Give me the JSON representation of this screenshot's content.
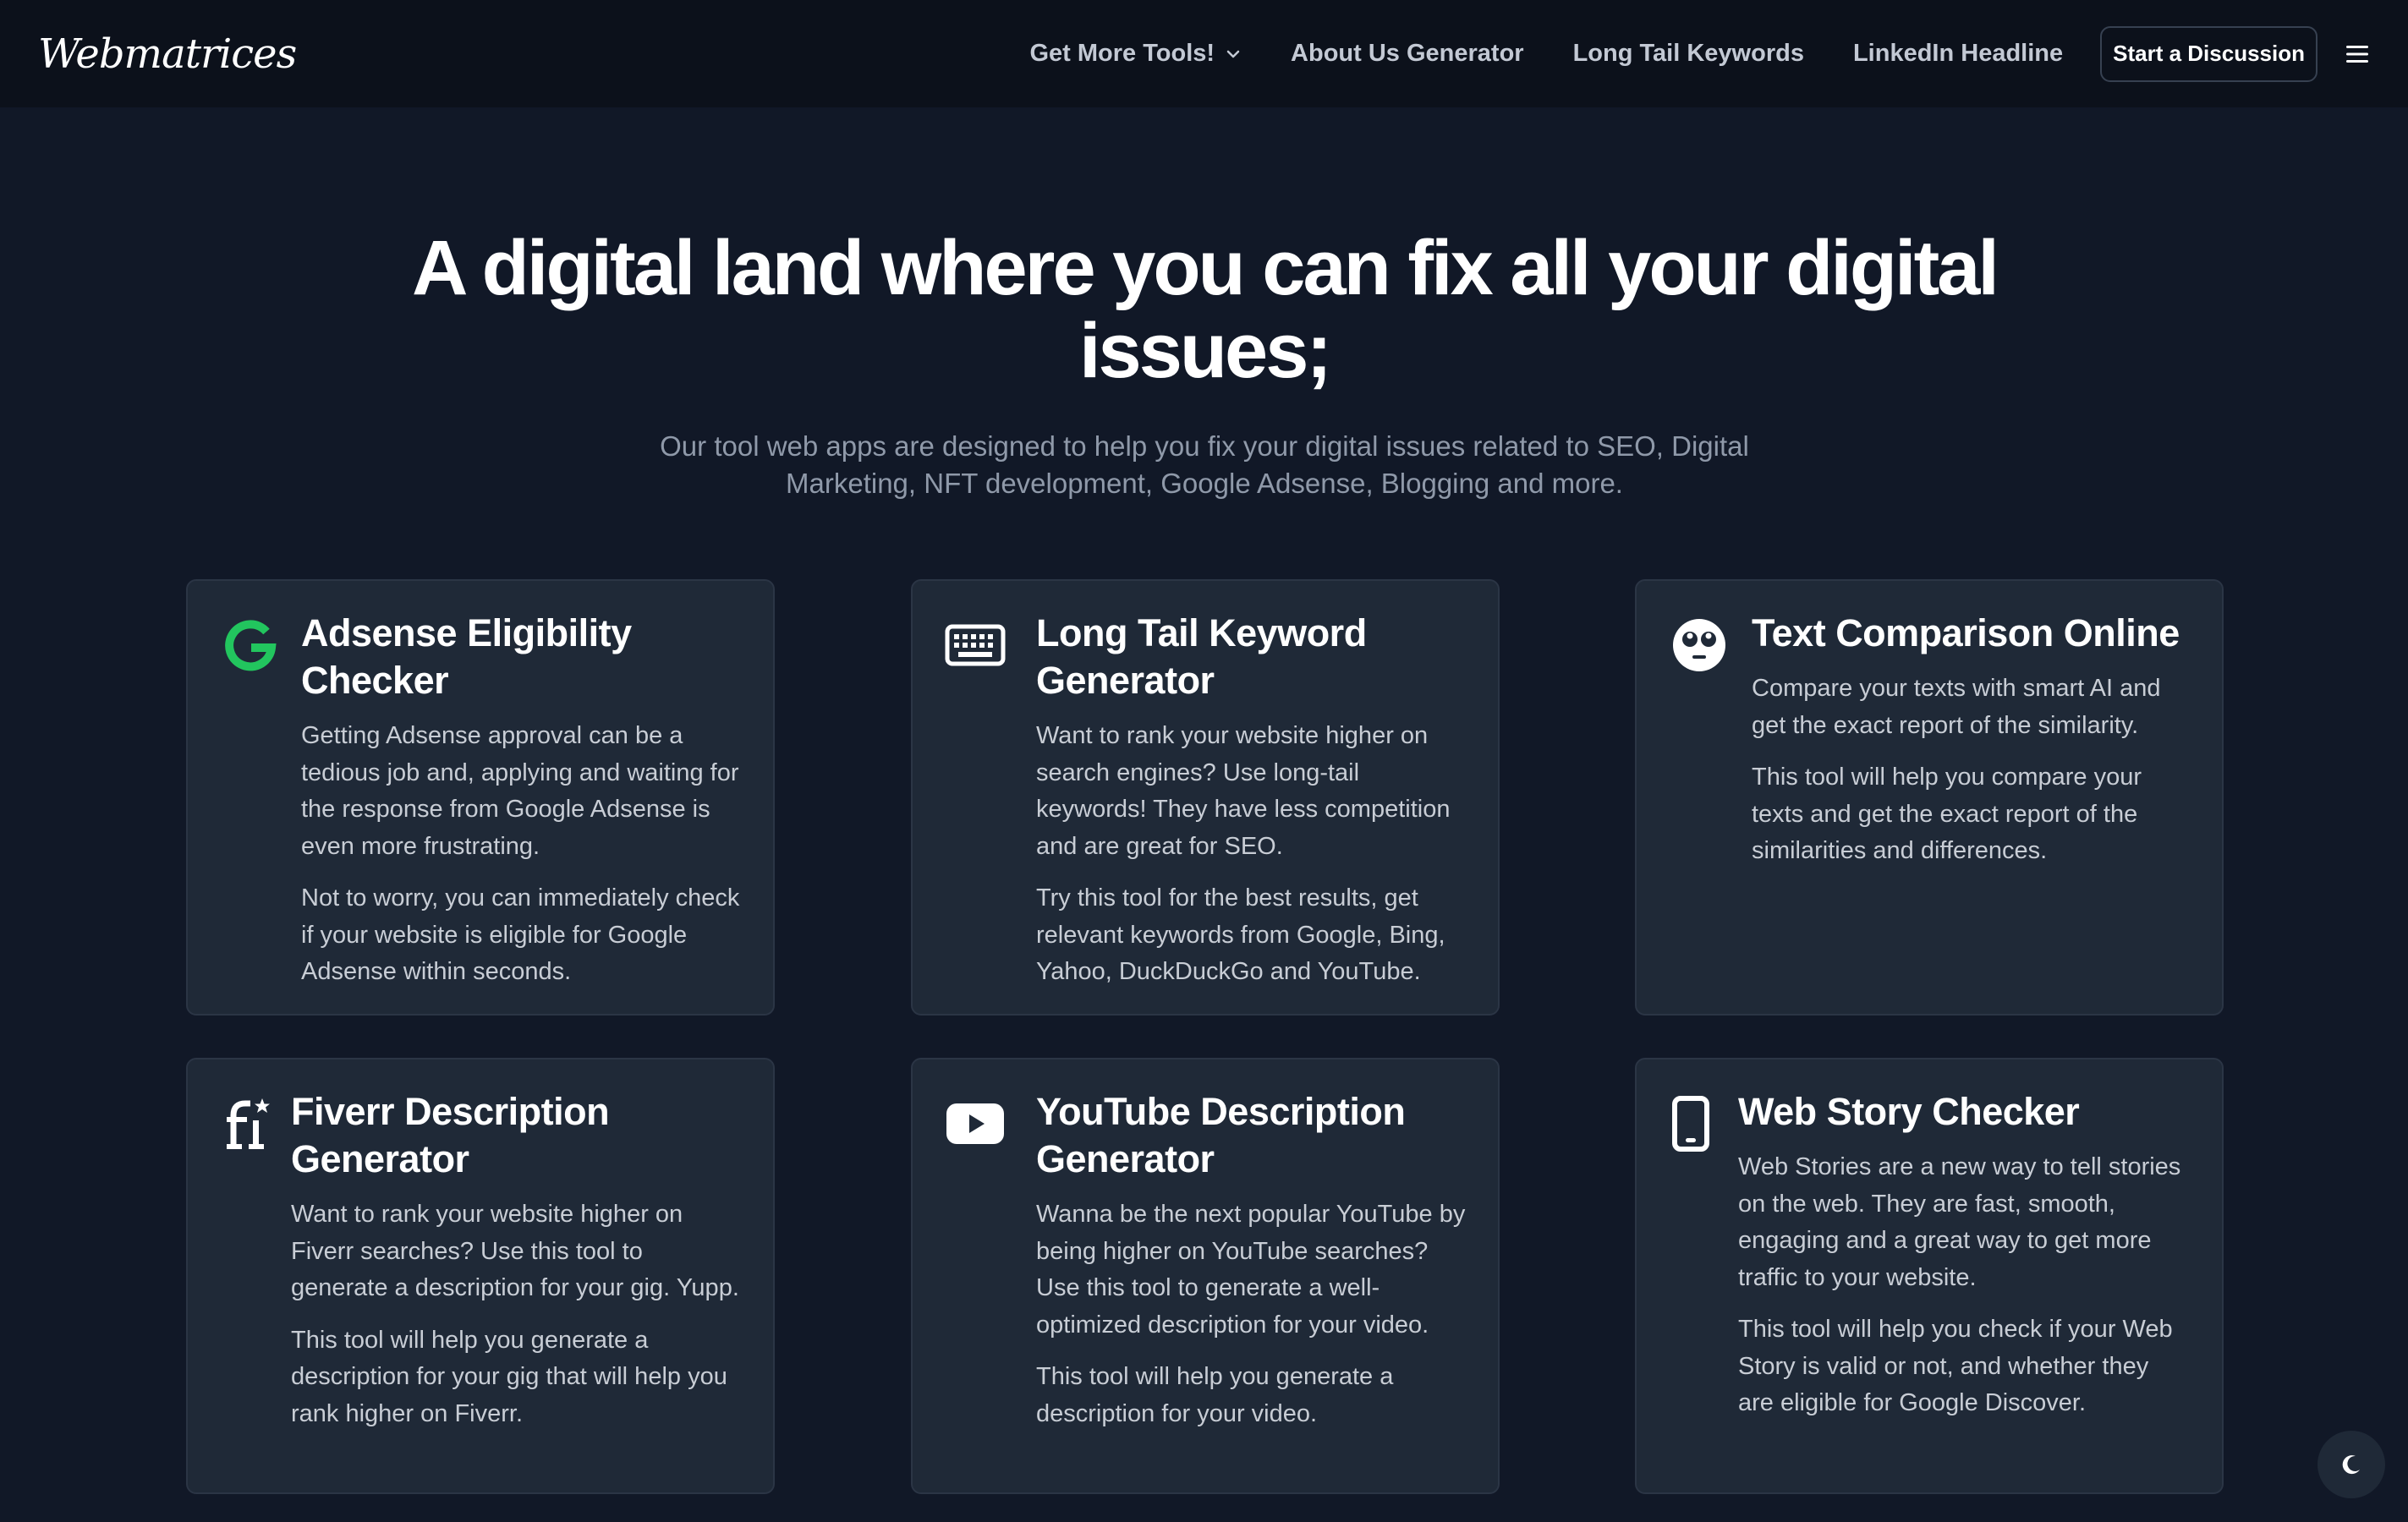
{
  "brand": {
    "logo_text": "Webmatrices"
  },
  "nav": {
    "items": [
      {
        "label": "Get More Tools!",
        "has_dropdown": true
      },
      {
        "label": "About Us Generator"
      },
      {
        "label": "Long Tail Keywords"
      },
      {
        "label": "LinkedIn Headline"
      }
    ],
    "cta_label": "Start a Discussion",
    "menu_icon": "hamburger-menu-icon"
  },
  "hero": {
    "title": "A digital land where you can fix all your digital issues;",
    "subtitle": "Our tool web apps are designed to help you fix your digital issues related to SEO, Digital Marketing, NFT development, Google Adsense, Blogging and more."
  },
  "cards": [
    {
      "icon": "google-g-icon",
      "title": "Adsense Eligibility Checker",
      "paragraphs": [
        "Getting Adsense approval can be a tedious job and, applying and waiting for the response from Google Adsense is even more frustrating.",
        "Not to worry, you can immediately check if your website is eligible for Google Adsense within seconds."
      ]
    },
    {
      "icon": "keyboard-icon",
      "title": "Long Tail Keyword Generator",
      "paragraphs": [
        "Want to rank your website higher on search engines? Use long-tail keywords! They have less competition and are great for SEO.",
        "Try this tool for the best results, get relevant keywords from Google, Bing, Yahoo, DuckDuckGo and YouTube."
      ]
    },
    {
      "icon": "eyes-face-icon",
      "title": "Text Comparison Online",
      "paragraphs": [
        "Compare your texts with smart AI and get the exact report of the similarity.",
        "This tool will help you compare your texts and get the exact report of the similarities and differences."
      ]
    },
    {
      "icon": "fiverr-fi-icon",
      "title": "Fiverr Description Generator",
      "paragraphs": [
        "Want to rank your website higher on Fiverr searches? Use this tool to generate a description for your gig. Yupp.",
        "This tool will help you generate a description for your gig that will help you rank higher on Fiverr."
      ]
    },
    {
      "icon": "youtube-play-icon",
      "title": "YouTube Description Generator",
      "paragraphs": [
        "Wanna be the next popular YouTube by being higher on YouTube searches? Use this tool to generate a well-optimized description for your video.",
        "This tool will help you generate a description for your video."
      ]
    },
    {
      "icon": "mobile-phone-icon",
      "title": "Web Story Checker",
      "paragraphs": [
        "Web Stories are a new way to tell stories on the web. They are fast, smooth, engaging and a great way to get more traffic to your website.",
        "This tool will help you check if your Web Story is valid or not, and whether they are eligible for Google Discover."
      ]
    }
  ],
  "theme_toggle": {
    "icon": "moon-icon"
  },
  "colors": {
    "page_bg": "#111827",
    "nav_bg": "#0c111b",
    "card_bg": "#1f2937",
    "google_green": "#22c55e"
  }
}
